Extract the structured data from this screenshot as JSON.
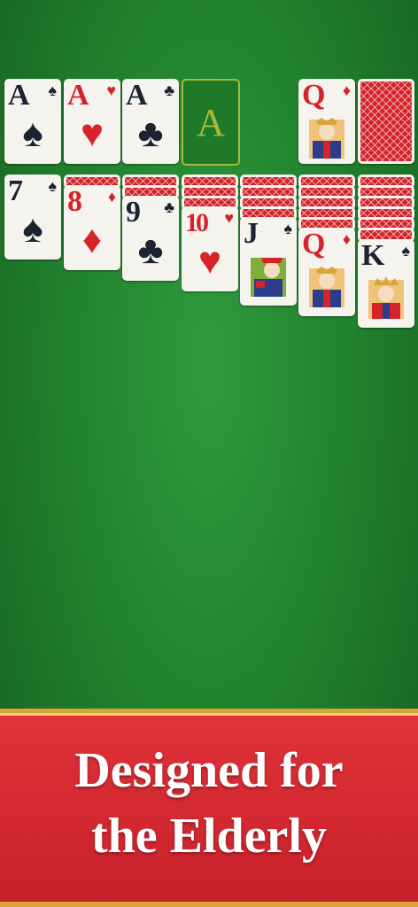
{
  "foundations": [
    {
      "rank": "A",
      "suit": "♠",
      "color": "black"
    },
    {
      "rank": "A",
      "suit": "♥",
      "color": "red"
    },
    {
      "rank": "A",
      "suit": "♣",
      "color": "black"
    },
    {
      "empty_label": "A"
    }
  ],
  "waste": {
    "rank": "Q",
    "suit": "♦",
    "color": "red"
  },
  "tableau": [
    {
      "rank": "7",
      "suit": "♠",
      "color": "black"
    },
    {
      "rank": "8",
      "suit": "♦",
      "color": "red"
    },
    {
      "rank": "9",
      "suit": "♣",
      "color": "black"
    },
    {
      "rank": "10",
      "suit": "♥",
      "color": "red"
    },
    {
      "rank": "J",
      "suit": "♠",
      "color": "black"
    },
    {
      "rank": "Q",
      "suit": "♦",
      "color": "red"
    },
    {
      "rank": "K",
      "suit": "♠",
      "color": "black"
    }
  ],
  "banner": {
    "line1": "Designed for",
    "line2": "the Elderly"
  },
  "colors": {
    "felt": "#1f7e2c",
    "banner_red": "#d6232a",
    "gold": "#d8a53b",
    "card_red": "#d6232a",
    "card_black": "#1b2230"
  }
}
